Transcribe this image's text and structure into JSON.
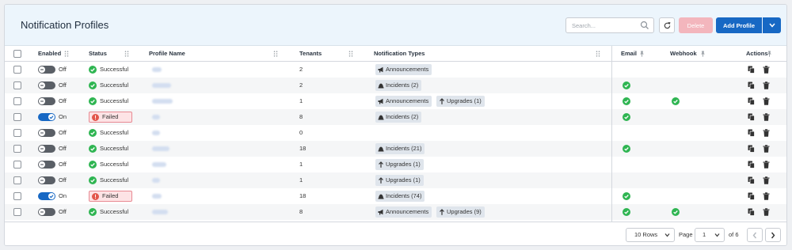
{
  "page": {
    "title": "Notification Profiles",
    "search_placeholder": "Search...",
    "delete_label": "Delete",
    "add_label": "Add Profile"
  },
  "columns": {
    "enabled": "Enabled",
    "status": "Status",
    "profile_name": "Profile Name",
    "tenants": "Tenants",
    "notification_types": "Notification Types",
    "email": "Email",
    "webhook": "Webhook",
    "actions": "Actions"
  },
  "rows": [
    {
      "enabled": "Off",
      "status": "Successful",
      "tenants": "2",
      "types": [
        "Announcements"
      ],
      "email": false,
      "webhook": false
    },
    {
      "enabled": "Off",
      "status": "Successful",
      "tenants": "2",
      "types": [
        "Incidents (2)"
      ],
      "email": true,
      "webhook": false
    },
    {
      "enabled": "Off",
      "status": "Successful",
      "tenants": "1",
      "types": [
        "Announcements",
        "Upgrades (1)"
      ],
      "email": true,
      "webhook": true
    },
    {
      "enabled": "On",
      "status": "Failed",
      "tenants": "8",
      "types": [
        "Incidents (2)"
      ],
      "email": true,
      "webhook": false
    },
    {
      "enabled": "Off",
      "status": "Successful",
      "tenants": "0",
      "types": [],
      "email": false,
      "webhook": false
    },
    {
      "enabled": "Off",
      "status": "Successful",
      "tenants": "18",
      "types": [
        "Incidents (21)"
      ],
      "email": true,
      "webhook": false
    },
    {
      "enabled": "Off",
      "status": "Successful",
      "tenants": "1",
      "types": [
        "Upgrades (1)"
      ],
      "email": false,
      "webhook": false
    },
    {
      "enabled": "Off",
      "status": "Successful",
      "tenants": "1",
      "types": [
        "Upgrades (1)"
      ],
      "email": false,
      "webhook": false
    },
    {
      "enabled": "On",
      "status": "Failed",
      "tenants": "18",
      "types": [
        "Incidents (74)"
      ],
      "email": true,
      "webhook": false
    },
    {
      "enabled": "Off",
      "status": "Successful",
      "tenants": "8",
      "types": [
        "Announcements",
        "Upgrades (9)"
      ],
      "email": true,
      "webhook": true
    }
  ],
  "footer": {
    "rows_per_page": "10 Rows",
    "page_label": "Page",
    "current_page": "1",
    "of_pages": "of 6"
  },
  "colors": {
    "primary": "#1768c4",
    "success": "#2fb552",
    "failed_bg": "#fde3e5",
    "failed_border": "#e88a93",
    "header_bg": "#ecf5fc",
    "tag_bg": "#dfe5ec"
  }
}
